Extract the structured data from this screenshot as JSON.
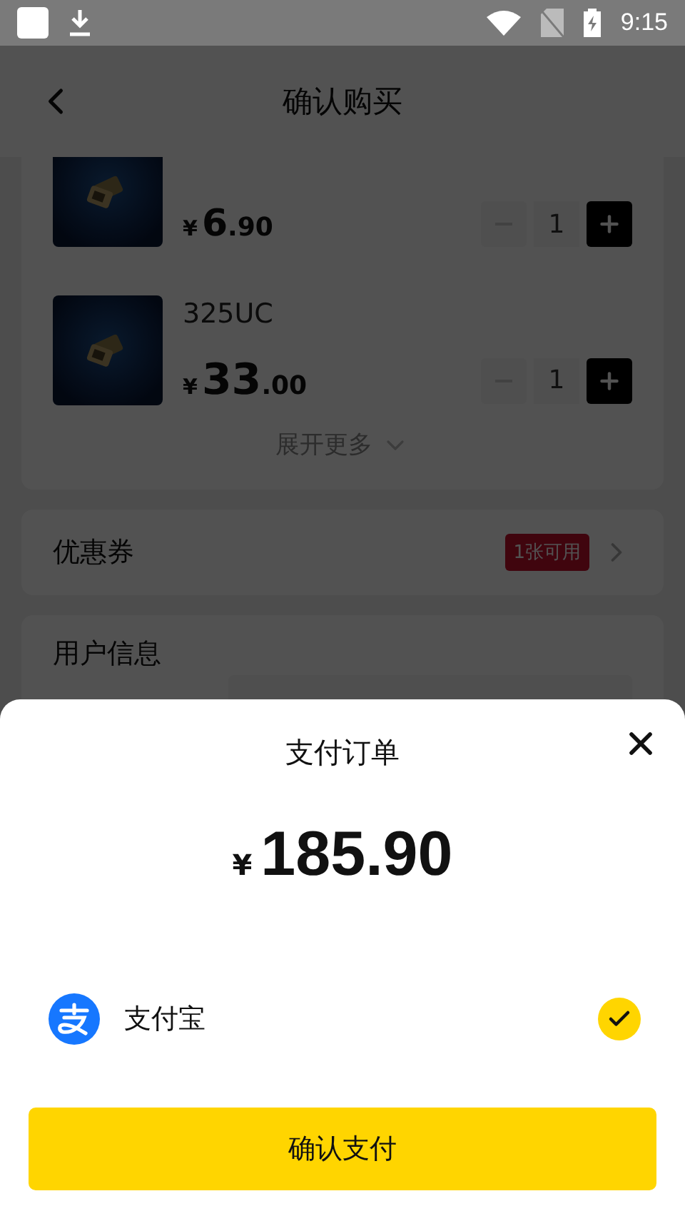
{
  "status_bar": {
    "time": "9:15"
  },
  "header": {
    "title": "确认购买"
  },
  "products": [
    {
      "price": {
        "currency": "¥",
        "integer": "6",
        "decimal": ".90"
      },
      "quantity": "1",
      "minus_disabled": true
    },
    {
      "name": "325UC",
      "price": {
        "currency": "¥",
        "integer": "33",
        "decimal": ".00"
      },
      "quantity": "1",
      "minus_disabled": true
    }
  ],
  "expand_more": "展开更多",
  "coupon": {
    "label": "优惠券",
    "badge": "1张可用"
  },
  "user_info": {
    "title": "用户信息"
  },
  "payment_sheet": {
    "title": "支付订单",
    "amount": {
      "currency": "¥",
      "value": "185.90"
    },
    "methods": [
      {
        "name": "支付宝",
        "selected": true
      }
    ],
    "confirm": "确认支付"
  }
}
